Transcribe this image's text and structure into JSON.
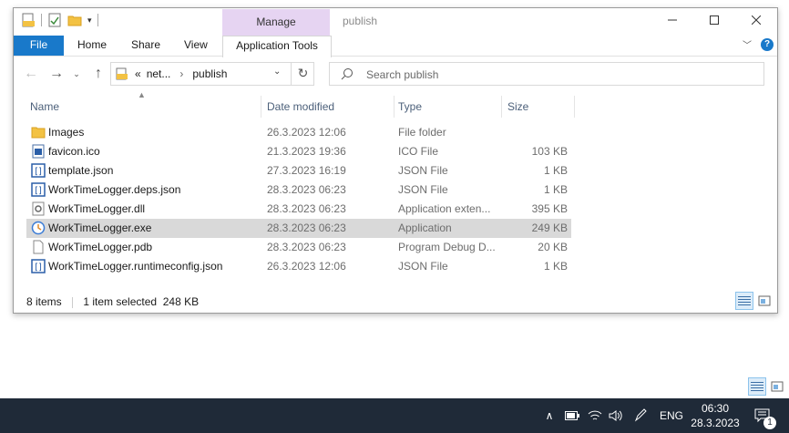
{
  "window": {
    "title": "publish",
    "context_tab_group": "Manage",
    "ribbon_tabs": [
      "File",
      "Home",
      "Share",
      "View",
      "Application Tools"
    ]
  },
  "nav": {
    "address": {
      "overflow": "«",
      "segments": [
        "net...",
        "publish"
      ]
    },
    "search_placeholder": "Search publish"
  },
  "columns": {
    "name": "Name",
    "date": "Date modified",
    "type": "Type",
    "size": "Size"
  },
  "files": [
    {
      "name": "Images",
      "date": "26.3.2023 12:06",
      "type": "File folder",
      "size": "",
      "icon": "folder-icon",
      "selected": false
    },
    {
      "name": "favicon.ico",
      "date": "21.3.2023 19:36",
      "type": "ICO File",
      "size": "103 KB",
      "icon": "image-file-icon",
      "selected": false
    },
    {
      "name": "template.json",
      "date": "27.3.2023 16:19",
      "type": "JSON File",
      "size": "1 KB",
      "icon": "json-file-icon",
      "selected": false
    },
    {
      "name": "WorkTimeLogger.deps.json",
      "date": "28.3.2023 06:23",
      "type": "JSON File",
      "size": "1 KB",
      "icon": "json-file-icon",
      "selected": false
    },
    {
      "name": "WorkTimeLogger.dll",
      "date": "28.3.2023 06:23",
      "type": "Application exten...",
      "size": "395 KB",
      "icon": "dll-file-icon",
      "selected": false
    },
    {
      "name": "WorkTimeLogger.exe",
      "date": "28.3.2023 06:23",
      "type": "Application",
      "size": "249 KB",
      "icon": "exe-file-icon",
      "selected": true
    },
    {
      "name": "WorkTimeLogger.pdb",
      "date": "28.3.2023 06:23",
      "type": "Program Debug D...",
      "size": "20 KB",
      "icon": "blank-file-icon",
      "selected": false
    },
    {
      "name": "WorkTimeLogger.runtimeconfig.json",
      "date": "26.3.2023 12:06",
      "type": "JSON File",
      "size": "1 KB",
      "icon": "json-file-icon",
      "selected": false
    }
  ],
  "status": {
    "items": "8 items",
    "selection": "1 item selected  248 KB"
  },
  "taskbar": {
    "language": "ENG",
    "time": "06:30",
    "date": "28.3.2023",
    "notification_count": "1"
  },
  "colors": {
    "accent": "#1979ca",
    "manage_tab": "#e6d4f2",
    "taskbar": "#1f2a38",
    "selected_row": "#d9d9d9"
  }
}
